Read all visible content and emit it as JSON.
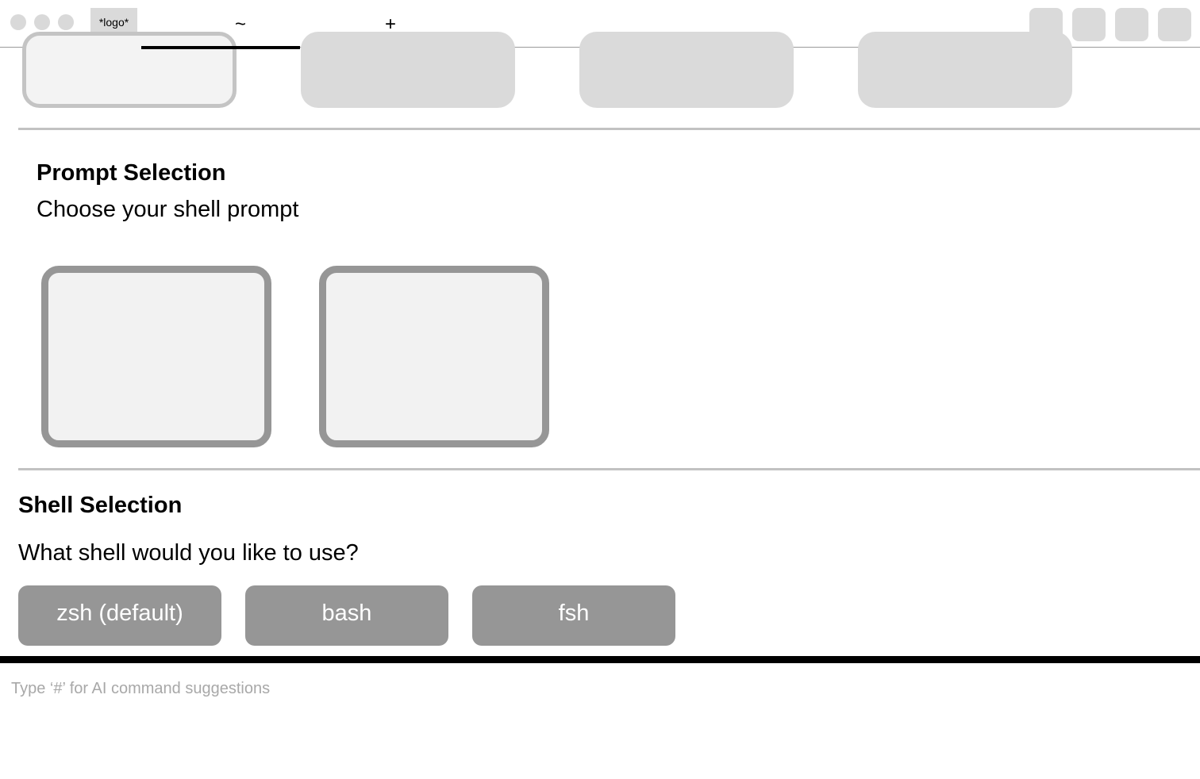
{
  "titlebar": {
    "logo_text": "*logo*",
    "active_tab_label": "~",
    "new_tab_label": "+"
  },
  "prompt_section": {
    "title": "Prompt Selection",
    "subtitle": "Choose your shell prompt"
  },
  "shell_section": {
    "title": "Shell Selection",
    "question": "What shell would you like to use?",
    "options": [
      {
        "label": "zsh (default)"
      },
      {
        "label": "bash"
      },
      {
        "label": "fsh"
      }
    ]
  },
  "input": {
    "placeholder": "Type ‘#’ for AI command suggestions",
    "value": ""
  },
  "colors": {
    "card_border": "#969696",
    "card_fill": "#f2f2f2",
    "button_fill": "#969696",
    "divider": "#c2c2c2"
  }
}
